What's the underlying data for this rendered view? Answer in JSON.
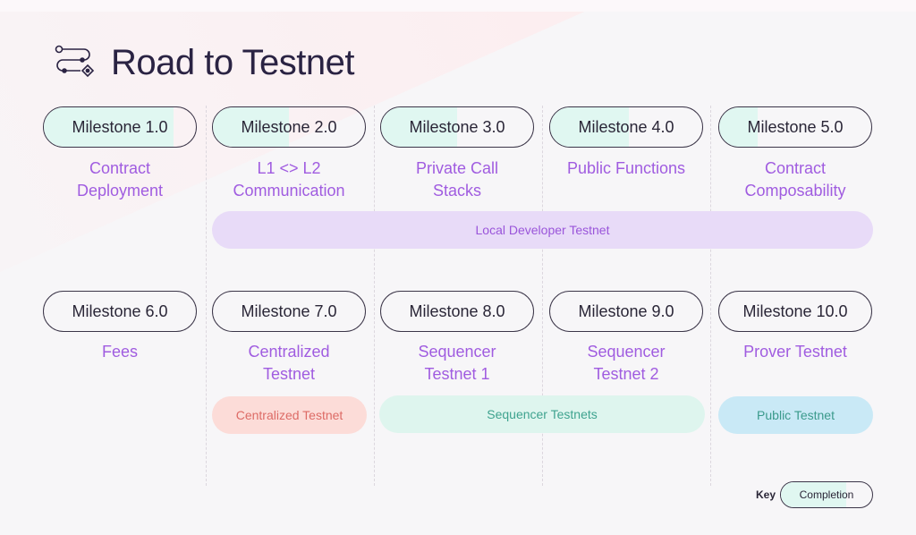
{
  "title": "Road to Testnet",
  "icon": "roadmap-path-icon",
  "milestones": [
    {
      "label": "Milestone 1.0",
      "description_lines": [
        "Contract",
        "Deployment"
      ],
      "completion": 0.85
    },
    {
      "label": "Milestone 2.0",
      "description_lines": [
        "L1 <> L2",
        "Communication"
      ],
      "completion": 0.5
    },
    {
      "label": "Milestone 3.0",
      "description_lines": [
        "Private Call",
        "Stacks"
      ],
      "completion": 0.5
    },
    {
      "label": "Milestone 4.0",
      "description_lines": [
        "Public Functions",
        ""
      ],
      "completion": 0.52
    },
    {
      "label": "Milestone 5.0",
      "description_lines": [
        "Contract",
        "Composability"
      ],
      "completion": 0.25
    },
    {
      "label": "Milestone 6.0",
      "description_lines": [
        "Fees",
        ""
      ],
      "completion": 0
    },
    {
      "label": "Milestone 7.0",
      "description_lines": [
        "Centralized",
        "Testnet"
      ],
      "completion": 0
    },
    {
      "label": "Milestone 8.0",
      "description_lines": [
        "Sequencer",
        "Testnet 1"
      ],
      "completion": 0
    },
    {
      "label": "Milestone 9.0",
      "description_lines": [
        "Sequencer",
        "Testnet 2"
      ],
      "completion": 0
    },
    {
      "label": "Milestone 10.0",
      "description_lines": [
        "Prover Testnet",
        ""
      ],
      "completion": 0
    }
  ],
  "phases": {
    "local": "Local Developer Testnet",
    "centralized": "Centralized Testnet",
    "sequencer": "Sequencer Testnets",
    "public": "Public Testnet"
  },
  "colors": {
    "completion": "#e0f7f1",
    "description": "#a05ce0",
    "local": "#e8dbf8",
    "centralized": "#fcdcd8",
    "sequencer": "#def5ee",
    "public": "#c9e9f6"
  },
  "key": {
    "label": "Key",
    "item": "Completion"
  }
}
